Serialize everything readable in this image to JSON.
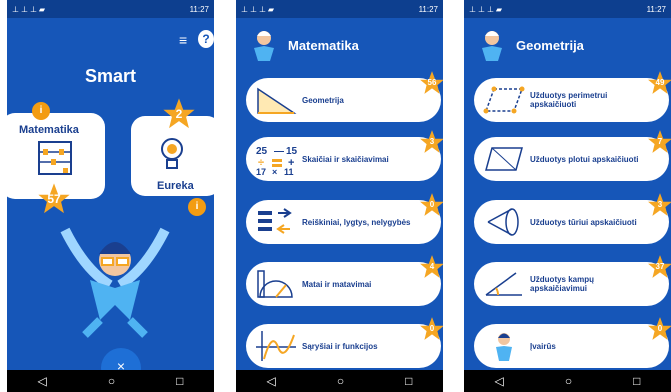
{
  "status": {
    "left_icons": "⊥⊥⊥▰",
    "time": "11:27",
    "right_icons": "▾▯"
  },
  "nav": {
    "back": "◁",
    "home": "○",
    "recent": "□"
  },
  "home": {
    "title": "Smart",
    "tile_math": {
      "label": "Matematika",
      "stars": "57",
      "info": "i"
    },
    "tile_eureka": {
      "label": "Eureka",
      "stars": "2",
      "info": "i"
    },
    "fab": "×"
  },
  "math": {
    "title": "Matematika",
    "items": [
      {
        "label": "Geometrija",
        "stars": "56"
      },
      {
        "label": "Skaičiai ir skaičiavimai",
        "stars": "3"
      },
      {
        "label": "Reiškiniai, lygtys, nelygybės",
        "stars": "0"
      },
      {
        "label": "Matai ir matavimai",
        "stars": "4"
      },
      {
        "label": "Sąryšiai ir funkcijos",
        "stars": "0"
      }
    ]
  },
  "geometry": {
    "title": "Geometrija",
    "items": [
      {
        "label": "Užduotys perimetrui apskaičiuoti",
        "stars": "49"
      },
      {
        "label": "Užduotys plotui apskaičiuoti",
        "stars": "7"
      },
      {
        "label": "Užduotys tūriui apskaičiuoti",
        "stars": "3"
      },
      {
        "label": "Užduotys kampų apskaičiavimui",
        "stars": "37"
      },
      {
        "label": "Įvairūs",
        "stars": "0"
      }
    ]
  },
  "colors": {
    "background": "#1656b8",
    "accent_star": "#f5a623",
    "text_primary": "#1a3f8f"
  }
}
